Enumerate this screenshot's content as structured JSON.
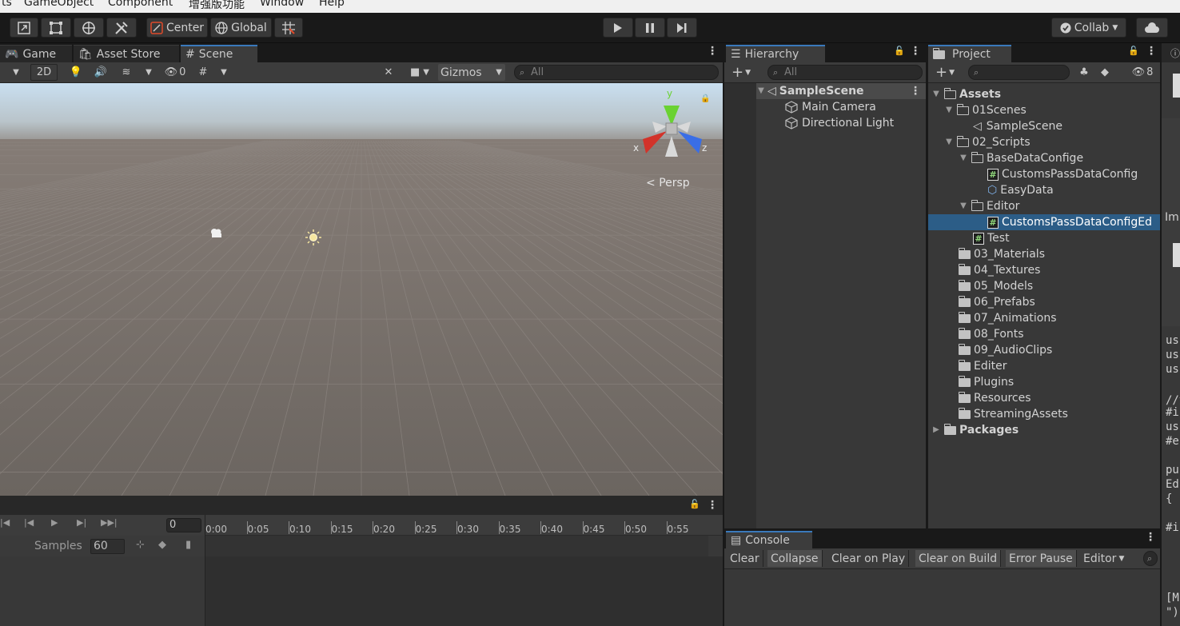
{
  "menu": {
    "items": [
      "ts",
      "GameObject",
      "Component",
      "增强版功能",
      "Window",
      "Help"
    ]
  },
  "toolbar": {
    "pivot_label": "Center",
    "space_label": "Global",
    "collab_label": "Collab",
    "play_icon": "play-icon",
    "pause_icon": "pause-icon",
    "step_icon": "step-icon"
  },
  "scene_tabs": [
    {
      "label": "Game",
      "icon": "gamepad-icon"
    },
    {
      "label": "Asset Store",
      "icon": "bag-icon"
    },
    {
      "label": "Scene",
      "icon": "grid-icon"
    }
  ],
  "scene_toolbar": {
    "mode_2d": "2D",
    "hidden_count": "0",
    "gizmos_label": "Gizmos",
    "search_placeholder": "All"
  },
  "scene_view": {
    "axis_x": "x",
    "axis_y": "y",
    "axis_z": "z",
    "persp_label": "Persp"
  },
  "hierarchy": {
    "tab_label": "Hierarchy",
    "search_placeholder": "All",
    "scene_name": "SampleScene",
    "objects": [
      "Main Camera",
      "Directional Light"
    ]
  },
  "project": {
    "tab_label": "Project",
    "hidden_count": "8",
    "assets_label": "Assets",
    "packages_label": "Packages",
    "tree": {
      "scenes_folder": "01Scenes",
      "sample_scene": "SampleScene",
      "scripts_folder": "02_Scripts",
      "basedata_folder": "BaseDataConfige",
      "customs_config": "CustomsPassDataConfig",
      "easydata": "EasyData",
      "editor_folder": "Editor",
      "customs_config_editor": "CustomsPassDataConfigEd",
      "test_script": "Test"
    },
    "folders": [
      "03_Materials",
      "04_Textures",
      "05_Models",
      "06_Prefabs",
      "07_Animations",
      "08_Fonts",
      "09_AudioClips",
      "Editer",
      "Plugins",
      "Resources",
      "StreamingAssets"
    ]
  },
  "animation": {
    "frame_value": "0",
    "samples_label": "Samples",
    "samples_value": "60",
    "ticks": [
      "0:00",
      "0:05",
      "0:10",
      "0:15",
      "0:20",
      "0:25",
      "0:30",
      "0:35",
      "0:40",
      "0:45",
      "0:50",
      "0:55"
    ]
  },
  "console": {
    "tab_label": "Console",
    "buttons": [
      "Clear",
      "Collapse",
      "Clear on Play",
      "Clear on Build",
      "Error Pause",
      "Editor"
    ]
  },
  "inspector": {
    "label": "Im",
    "code": [
      "us",
      "us",
      "us",
      "//注",
      "#if",
      "us",
      "#e",
      "pu",
      "Ed",
      "{",
      "#if",
      "[M",
      "\")]"
    ]
  },
  "colors": {
    "selection": "#2c5d87",
    "tab_accent": "#3a79bb",
    "axis_x": "#d2332a",
    "axis_y": "#6ad232",
    "axis_z": "#3a6ee6"
  }
}
